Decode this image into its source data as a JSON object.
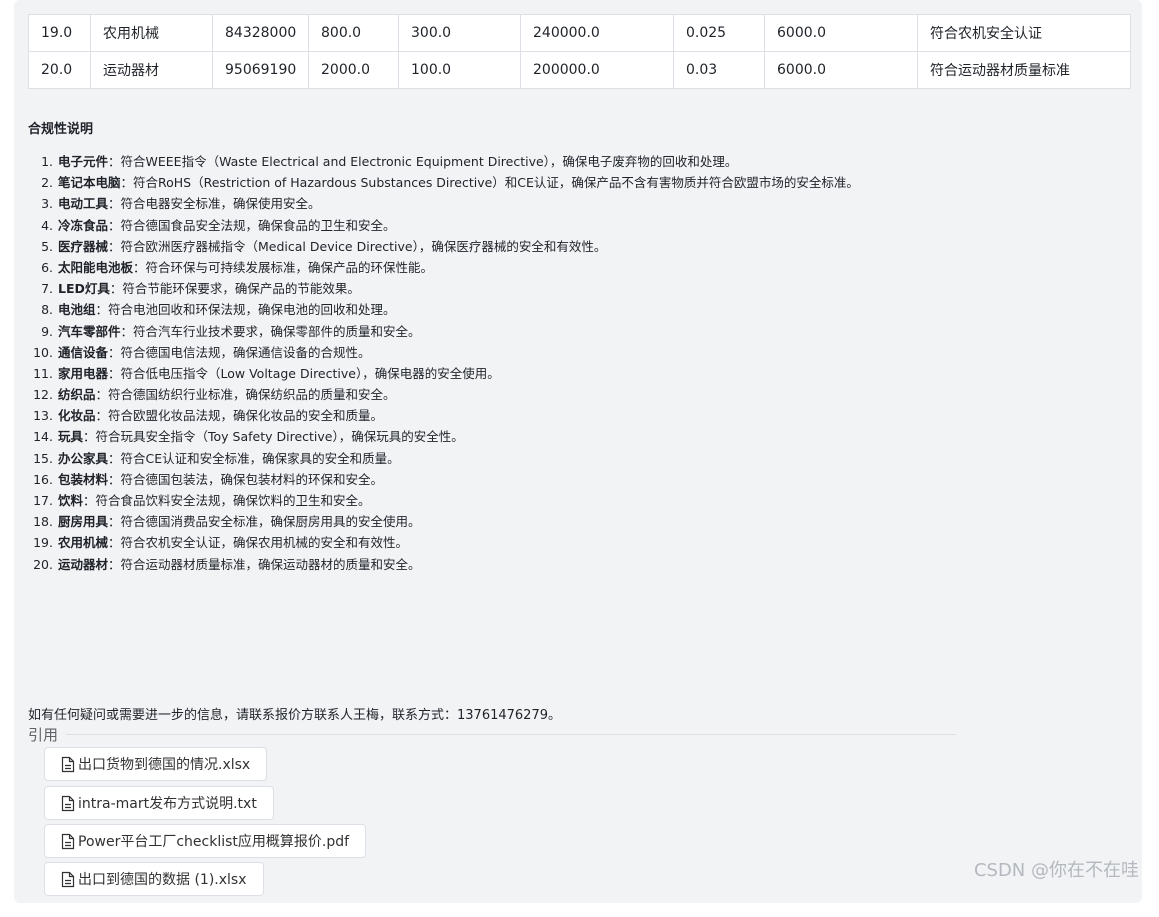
{
  "table": {
    "rows": [
      [
        "19.0",
        "农用机械",
        "84328000",
        "800.0",
        "300.0",
        "240000.0",
        "0.025",
        "6000.0",
        "符合农机安全认证"
      ],
      [
        "20.0",
        "运动器材",
        "95069190",
        "2000.0",
        "100.0",
        "200000.0",
        "0.03",
        "6000.0",
        "符合运动器材质量标准"
      ]
    ]
  },
  "compliance": {
    "heading": "合规性说明",
    "items": [
      {
        "num": "1.",
        "term": "电子元件",
        "text": "：符合WEEE指令（Waste Electrical and Electronic Equipment Directive），确保电子废弃物的回收和处理。"
      },
      {
        "num": "2.",
        "term": "笔记本电脑",
        "text": "：符合RoHS（Restriction of Hazardous Substances Directive）和CE认证，确保产品不含有害物质并符合欧盟市场的安全标准。"
      },
      {
        "num": "3.",
        "term": "电动工具",
        "text": "：符合电器安全标准，确保使用安全。"
      },
      {
        "num": "4.",
        "term": "冷冻食品",
        "text": "：符合德国食品安全法规，确保食品的卫生和安全。"
      },
      {
        "num": "5.",
        "term": "医疗器械",
        "text": "：符合欧洲医疗器械指令（Medical Device Directive），确保医疗器械的安全和有效性。"
      },
      {
        "num": "6.",
        "term": "太阳能电池板",
        "text": "：符合环保与可持续发展标准，确保产品的环保性能。"
      },
      {
        "num": "7.",
        "term": "LED灯具",
        "text": "：符合节能环保要求，确保产品的节能效果。"
      },
      {
        "num": "8.",
        "term": "电池组",
        "text": "：符合电池回收和环保法规，确保电池的回收和处理。"
      },
      {
        "num": "9.",
        "term": "汽车零部件",
        "text": "：符合汽车行业技术要求，确保零部件的质量和安全。"
      },
      {
        "num": "10.",
        "term": "通信设备",
        "text": "：符合德国电信法规，确保通信设备的合规性。"
      },
      {
        "num": "11.",
        "term": "家用电器",
        "text": "：符合低电压指令（Low Voltage Directive），确保电器的安全使用。"
      },
      {
        "num": "12.",
        "term": "纺织品",
        "text": "：符合德国纺织行业标准，确保纺织品的质量和安全。"
      },
      {
        "num": "13.",
        "term": "化妆品",
        "text": "：符合欧盟化妆品法规，确保化妆品的安全和质量。"
      },
      {
        "num": "14.",
        "term": "玩具",
        "text": "：符合玩具安全指令（Toy Safety Directive），确保玩具的安全性。"
      },
      {
        "num": "15.",
        "term": "办公家具",
        "text": "：符合CE认证和安全标准，确保家具的安全和质量。"
      },
      {
        "num": "16.",
        "term": "包装材料",
        "text": "：符合德国包装法，确保包装材料的环保和安全。"
      },
      {
        "num": "17.",
        "term": "饮料",
        "text": "：符合食品饮料安全法规，确保饮料的卫生和安全。"
      },
      {
        "num": "18.",
        "term": "厨房用具",
        "text": "：符合德国消费品安全标准，确保厨房用具的安全使用。"
      },
      {
        "num": "19.",
        "term": "农用机械",
        "text": "：符合农机安全认证，确保农用机械的安全和有效性。"
      },
      {
        "num": "20.",
        "term": "运动器材",
        "text": "：符合运动器材质量标准，确保运动器材的质量和安全。"
      }
    ]
  },
  "contact": "如有任何疑问或需要进一步的信息，请联系报价方联系人王梅，联系方式：13761476279。",
  "references": {
    "label": "引用",
    "files": [
      {
        "name": "出口货物到德国的情况.xlsx",
        "icon": "file-icon"
      },
      {
        "name": "intra-mart发布方式说明.txt",
        "icon": "file-icon"
      },
      {
        "name": "Power平台工厂checklist应用概算报价.pdf",
        "icon": "file-icon"
      },
      {
        "name": "出口到德国的数据 (1).xlsx",
        "icon": "file-icon"
      }
    ]
  },
  "watermark": "CSDN @你在不在哇",
  "colors": {
    "panel_bg": "#f2f3f5",
    "border": "#dcdfe6",
    "text": "#1f2329"
  }
}
